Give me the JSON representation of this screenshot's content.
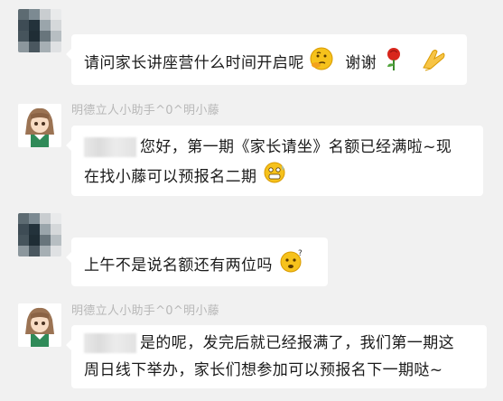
{
  "messages": [
    {
      "sender": "",
      "text": "请问家长讲座营什么时间开启呢",
      "text2": "谢谢"
    },
    {
      "sender": "明德立人小助手^0^明小藤",
      "line1": "您好，第一期《家长请坐》名额已经满啦~现",
      "line2": "在找小藤可以预报名二期"
    },
    {
      "sender": "",
      "text": "上午不是说名额还有两位吗"
    },
    {
      "sender": "明德立人小助手^0^明小藤",
      "line1": "是的呢，发完后就已经报满了，我们第一期这",
      "line2": "周日线下举办，家长们想参加可以预报名下一期哒~"
    }
  ],
  "colors": {
    "background": "#f1f1f1",
    "bubble": "#ffffff",
    "sender_name": "#b8b8b8"
  },
  "icons": [
    "pixelated-avatar",
    "assistant-girl-avatar",
    "thinking-face-emoji",
    "rose-emoji",
    "clap-hands-emoji",
    "grimacing-face-emoji",
    "confused-face-emoji"
  ]
}
